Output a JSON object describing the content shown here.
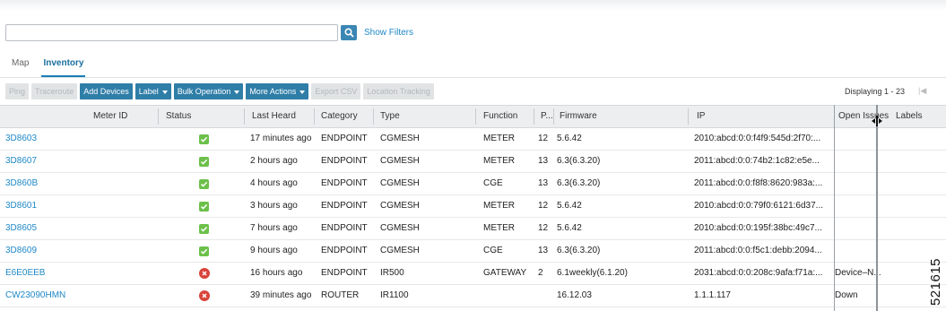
{
  "search": {
    "value": "",
    "placeholder": ""
  },
  "show_filters": "Show Filters",
  "tabs": [
    {
      "label": "Map"
    },
    {
      "label": "Inventory"
    }
  ],
  "toolbar": [
    {
      "label": "Ping",
      "enabled": false
    },
    {
      "label": "Traceroute",
      "enabled": false
    },
    {
      "label": "Add Devices",
      "enabled": true
    },
    {
      "label": "Label",
      "enabled": true,
      "dropdown": true
    },
    {
      "label": "Bulk Operation",
      "enabled": true,
      "dropdown": true
    },
    {
      "label": "More Actions",
      "enabled": true,
      "dropdown": true
    },
    {
      "label": "Export CSV",
      "enabled": false
    },
    {
      "label": "Location Tracking",
      "enabled": false
    }
  ],
  "paging": {
    "text": "Displaying 1 - 23"
  },
  "columns": [
    "Meter ID",
    "Status",
    "Last Heard",
    "Category",
    "Type",
    "Function",
    "P...",
    "Firmware",
    "IP",
    "Open Issues",
    "Labels"
  ],
  "rows": [
    {
      "name": "3D8603",
      "meter_id": "",
      "status": "ok",
      "last_heard": "17 minutes ago",
      "category": "ENDPOINT",
      "type": "CGMESH",
      "function": "METER",
      "p": "12",
      "firmware": "5.6.42",
      "ip": "2010:abcd:0:0:f4f9:545d:2f70:...",
      "open_issues": "",
      "labels": ""
    },
    {
      "name": "3D8607",
      "meter_id": "",
      "status": "ok",
      "last_heard": "2 hours ago",
      "category": "ENDPOINT",
      "type": "CGMESH",
      "function": "METER",
      "p": "13",
      "firmware": "6.3(6.3.20)",
      "ip": "2011:abcd:0:0:74b2:1c82:e5e...",
      "open_issues": "",
      "labels": ""
    },
    {
      "name": "3D860B",
      "meter_id": "",
      "status": "ok",
      "last_heard": "4 hours ago",
      "category": "ENDPOINT",
      "type": "CGMESH",
      "function": "CGE",
      "p": "13",
      "firmware": "6.3(6.3.20)",
      "ip": "2011:abcd:0:0:f8f8:8620:983a:...",
      "open_issues": "",
      "labels": ""
    },
    {
      "name": "3D8601",
      "meter_id": "",
      "status": "ok",
      "last_heard": "3 hours ago",
      "category": "ENDPOINT",
      "type": "CGMESH",
      "function": "METER",
      "p": "12",
      "firmware": "5.6.42",
      "ip": "2010:abcd:0:0:79f0:6121:6d37...",
      "open_issues": "",
      "labels": ""
    },
    {
      "name": "3D8605",
      "meter_id": "",
      "status": "ok",
      "last_heard": "7 hours ago",
      "category": "ENDPOINT",
      "type": "CGMESH",
      "function": "METER",
      "p": "12",
      "firmware": "5.6.42",
      "ip": "2010:abcd:0:0:195f:38bc:49c7...",
      "open_issues": "",
      "labels": ""
    },
    {
      "name": "3D8609",
      "meter_id": "",
      "status": "ok",
      "last_heard": "9 hours ago",
      "category": "ENDPOINT",
      "type": "CGMESH",
      "function": "CGE",
      "p": "13",
      "firmware": "6.3(6.3.20)",
      "ip": "2011:abcd:0:0:f5c1:debb:2094...",
      "open_issues": "",
      "labels": ""
    },
    {
      "name": "E6E0EEB",
      "meter_id": "",
      "status": "error",
      "last_heard": "16 hours ago",
      "category": "ENDPOINT",
      "type": "IR500",
      "function": "GATEWAY",
      "p": "2",
      "firmware": "6.1weekly(6.1.20)",
      "ip": "2031:abcd:0:0:208c:9afa:f71a:...",
      "open_issues": "Device–N...",
      "labels": ""
    },
    {
      "name": "CW23090HMN",
      "meter_id": "",
      "status": "error",
      "last_heard": "39 minutes ago",
      "category": "ROUTER",
      "type": "IR1100",
      "function": "",
      "p": "",
      "firmware": "16.12.03",
      "ip": "1.1.1.117",
      "open_issues": "Down",
      "labels": ""
    }
  ],
  "colors": {
    "link": "#1e88c7",
    "button": "#2f7ea8",
    "ok": "#6cc04a",
    "error": "#d9443a"
  },
  "icons": {
    "search": "magnifier-icon",
    "ok": "check-square-icon",
    "error": "x-circle-icon",
    "first_page": "first-page-icon",
    "cursor": "column-resize-cursor-icon"
  },
  "figure_id": "521615"
}
